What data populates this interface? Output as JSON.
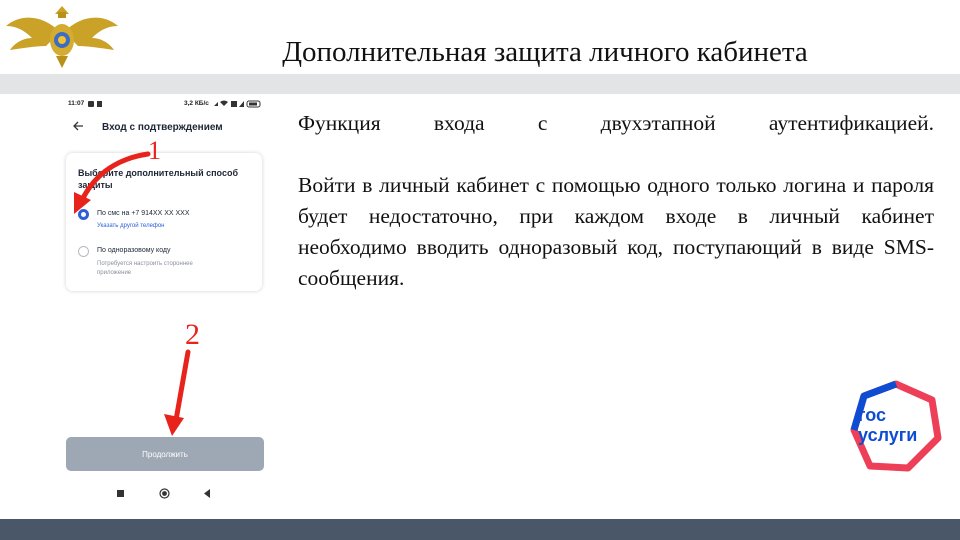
{
  "slide": {
    "title": "Дополнительная защита личного кабинета",
    "paragraph_1": "Функция входа с двухэтапной аутентификацией.",
    "paragraph_2": "Войти в личный кабинет с помощью одного только логина и пароля будет недостаточно, при каждом входе в личный кабинет необходимо вводить одноразовый код, поступающий в виде SMS-сообщения."
  },
  "phone": {
    "status_time": "11:07",
    "status_speed": "3,2 КБ/с",
    "screen_title": "Вход с подтверждением",
    "card_heading": "Выберите дополнительный способ защиты",
    "option_sms": {
      "label": "По смс на +7 914XX XX XXX",
      "link": "Указать другой телефон",
      "selected": true
    },
    "option_otp": {
      "label": "По одноразовому коду",
      "hint": "Потребуется настроить стороннее приложение",
      "selected": false
    },
    "continue_button": "Продолжить"
  },
  "annotations": {
    "step_1": "1",
    "step_2": "2",
    "arrow_color": "#e8231c"
  },
  "logo": {
    "line_1": "гос",
    "line_2": "услуги"
  },
  "colors": {
    "title_band": "#e3e4e6",
    "bottom_band": "#4a5769",
    "accent_blue": "#2e5fd6",
    "logo_blue": "#0d4cd3",
    "logo_red": "#ee3f58",
    "button_gray": "#9ea7b4"
  },
  "icons": [
    "eagle-emblem-icon",
    "back-arrow-icon",
    "radio-selected-icon",
    "radio-unselected-icon",
    "nav-recent-icon",
    "nav-home-icon",
    "nav-back-icon"
  ]
}
